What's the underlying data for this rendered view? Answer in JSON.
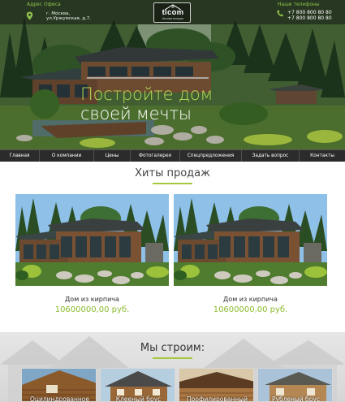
{
  "header": {
    "office_title": "Адрес Офиса",
    "office_line1": "г. Москва,",
    "office_line2": "ул.Уржумская, д.7.",
    "logo_name": "ticom",
    "logo_sub": "Автоматизация",
    "phones_title": "Наши телефоны",
    "phone1": "+7 800 800 80 80",
    "phone2": "+7 800 800 80 80"
  },
  "hero": {
    "line1": "Постройте дом",
    "line2": "своей мечты"
  },
  "nav": {
    "items": [
      "Главная",
      "О компании",
      "Цены",
      "Фотогалерея",
      "Спецпредложения",
      "Задать вопрос",
      "Контакты"
    ]
  },
  "hits": {
    "title": "Хиты продаж",
    "cards": [
      {
        "name": "Дом из кирпича",
        "price": "10600000,00 руб."
      },
      {
        "name": "Дом из кирпича",
        "price": "10600000,00 руб."
      }
    ]
  },
  "build": {
    "title": "Мы строим:",
    "tiles": [
      "Оцилиндрованное",
      "Клееный брус",
      "Профилированный",
      "Рубленый брус"
    ]
  },
  "colors": {
    "accent": "#a6c83e",
    "price": "#8cbb2e",
    "nav_bg": "#2b2b2b",
    "hero_highlight": "#b8dd55"
  },
  "icons": [
    "location-pin-icon",
    "phone-icon",
    "logo-house-icon"
  ]
}
